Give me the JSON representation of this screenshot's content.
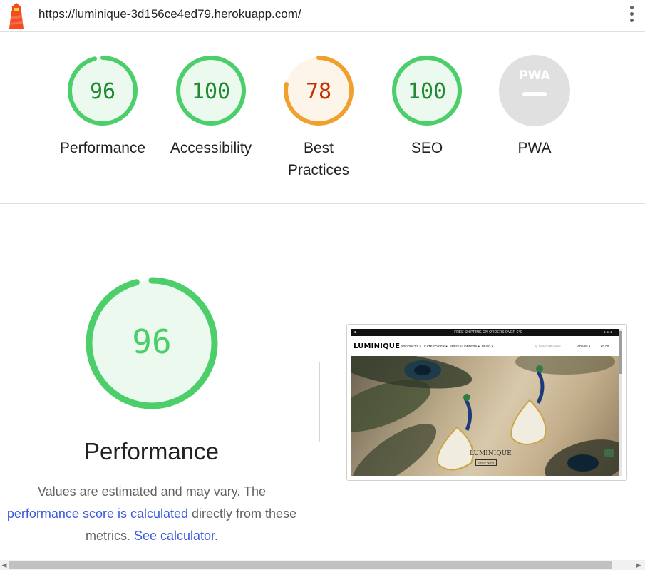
{
  "toolbar": {
    "url": "https://luminique-3d156ce4ed79.herokuapp.com/",
    "icon": "lighthouse-logo-icon",
    "menu_icon": "kebab-menu-icon"
  },
  "scores": [
    {
      "label": "Performance",
      "value": "96",
      "fraction": 0.96,
      "status": "pass"
    },
    {
      "label": "Accessibility",
      "value": "100",
      "fraction": 1.0,
      "status": "pass"
    },
    {
      "label": "Best Practices",
      "value": "78",
      "fraction": 0.78,
      "status": "average"
    },
    {
      "label": "SEO",
      "value": "100",
      "fraction": 1.0,
      "status": "pass"
    },
    {
      "label": "PWA",
      "value": "",
      "fraction": 0,
      "status": "na",
      "badge": "PWA"
    }
  ],
  "colors": {
    "pass_stroke": "#0cce6b",
    "pass_ring": "#4ccf6a",
    "pass_fill": "#ecf9ef",
    "pass_text": "#218a33",
    "average_stroke": "#f0a02c",
    "average_fill": "#fef5ea",
    "average_text": "#c33300",
    "na_fill": "#e0e0e0",
    "link": "#3b5bdb"
  },
  "performance": {
    "score": "96",
    "fraction": 0.96,
    "title": "Performance",
    "desc_before": "Values are estimated and may vary. The",
    "link_score": "performance score is calculated",
    "desc_middle": "directly from these",
    "desc_metrics": "metrics.",
    "link_calculator": "See calculator."
  },
  "screenshot": {
    "topbar_text": "FREE SHIPPING ON ORDERS OVER €40",
    "brand": "LUMINIQUE",
    "menu": [
      "PRODUCTS ▾",
      "CATEGORIES ▾",
      "SPECIAL OFFERS ▾",
      "BLOG ▾"
    ],
    "search_placeholder": "Search Product...",
    "account": "ADMIN ▾",
    "cart": "€0.00",
    "hero_title": "LUMINIQUE",
    "hero_button": "SHOP NOW"
  }
}
